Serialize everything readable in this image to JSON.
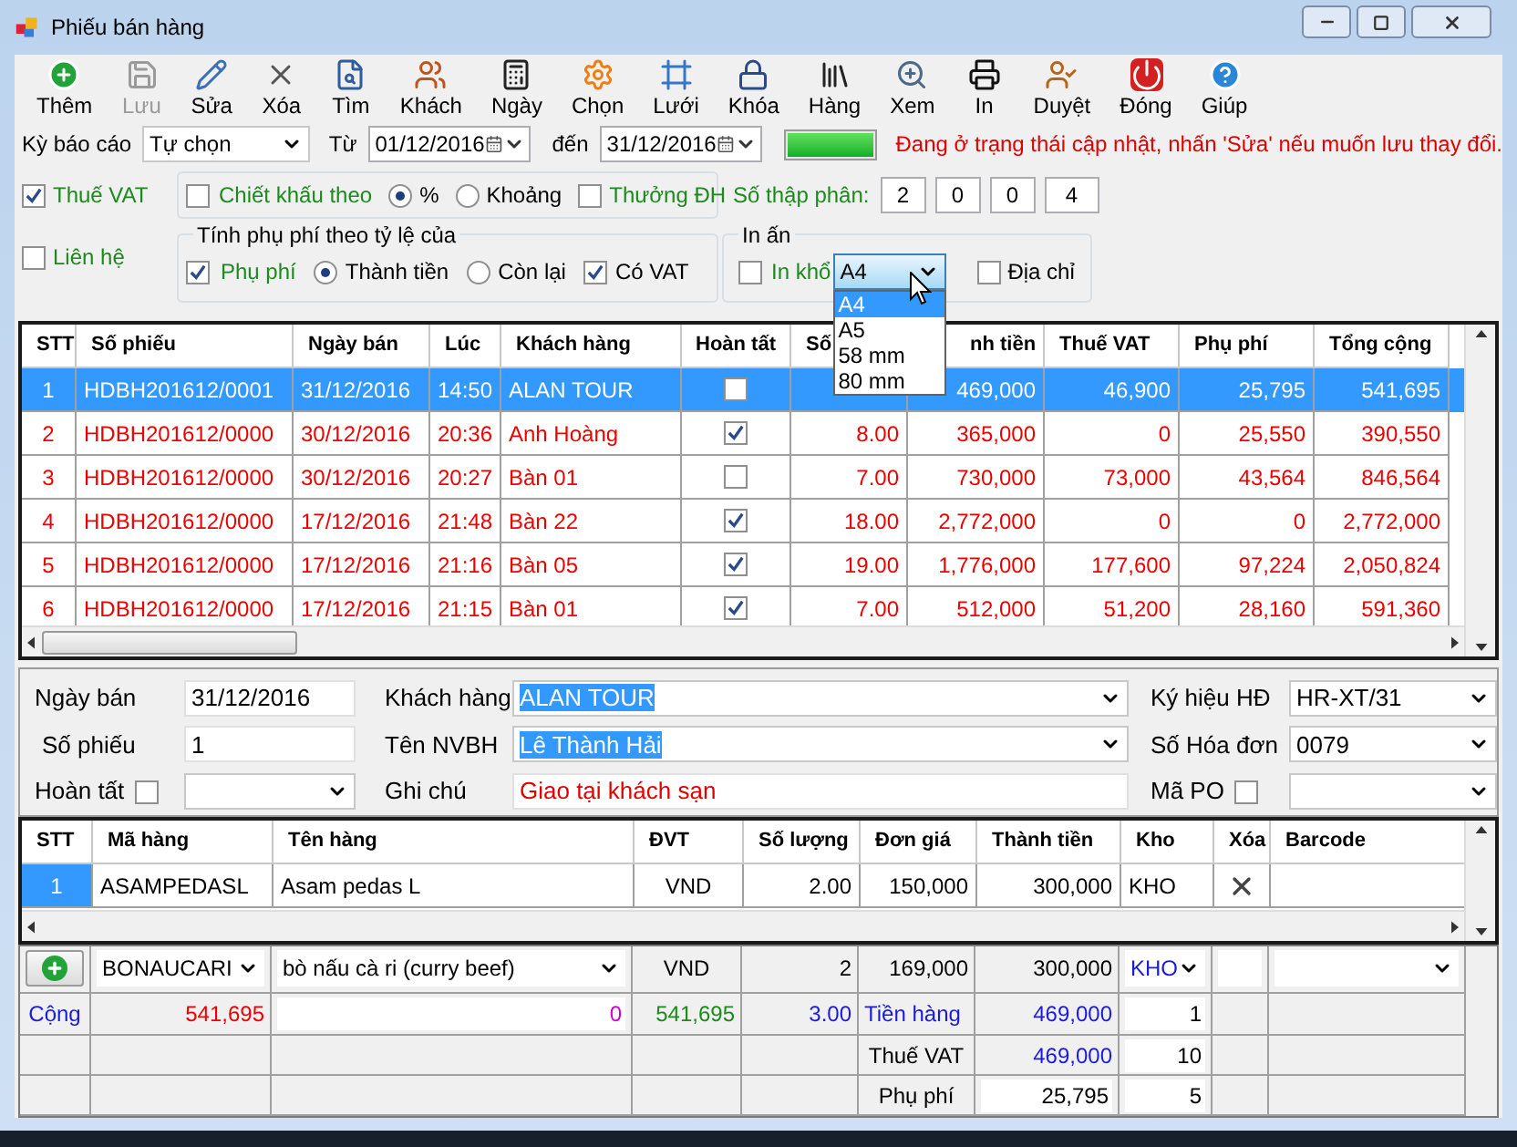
{
  "window": {
    "title": "Phiếu bán hàng"
  },
  "toolbar": [
    {
      "label": "Thêm",
      "disabled": false
    },
    {
      "label": "Lưu",
      "disabled": true
    },
    {
      "label": "Sửa",
      "disabled": false
    },
    {
      "label": "Xóa",
      "disabled": false
    },
    {
      "label": "Tìm",
      "disabled": false
    },
    {
      "label": "Khách",
      "disabled": false
    },
    {
      "label": "Ngày",
      "disabled": false
    },
    {
      "label": "Chọn",
      "disabled": false
    },
    {
      "label": "Lưới",
      "disabled": false
    },
    {
      "label": "Khóa",
      "disabled": false
    },
    {
      "label": "Hàng",
      "disabled": false
    },
    {
      "label": "Xem",
      "disabled": false
    },
    {
      "label": "In",
      "disabled": false
    },
    {
      "label": "Duyệt",
      "disabled": false
    },
    {
      "label": "Đóng",
      "disabled": false
    },
    {
      "label": "Giúp",
      "disabled": false
    }
  ],
  "filters": {
    "period_label": "Kỳ báo cáo",
    "period_value": "Tự chọn",
    "from_label": "Từ",
    "from_value": "01/12/2016",
    "to_label": "đến",
    "to_value": "31/12/2016",
    "progress": {
      "level": 1
    },
    "message": "Đang ở trạng thái cập nhật, nhấn 'Sửa' nếu muốn lưu thay đổi."
  },
  "options": {
    "vat": {
      "label": "Thuế VAT",
      "checked": true
    },
    "discount": {
      "label": "Chiết khấu theo",
      "checked": false
    },
    "discount_modes": [
      {
        "label": "%",
        "selected": true
      },
      {
        "label": "Khoảng",
        "selected": false
      }
    ],
    "bonus": {
      "label": "Thưởng ĐH",
      "checked": false
    },
    "decimals": {
      "label": "Số thập phân:",
      "values": [
        "2",
        "0",
        "0",
        "4"
      ]
    },
    "contact": {
      "label": "Liên hệ",
      "checked": false
    },
    "surcharge_group": {
      "title": "Tính phụ phí theo tỷ lệ của",
      "surcharge": {
        "label": "Phụ phí",
        "checked": true
      },
      "bases": [
        {
          "label": "Thành tiền",
          "selected": true
        },
        {
          "label": "Còn lại",
          "selected": false
        }
      ],
      "with_vat": {
        "label": "Có VAT",
        "checked": true
      }
    },
    "print_group": {
      "title": "In ấn",
      "paper": {
        "label": "In khổ",
        "checked": false
      },
      "paper_size": {
        "value": "A4",
        "expanded": true,
        "options": [
          {
            "label": "A4",
            "selected": true
          },
          {
            "label": "A5",
            "selected": false
          },
          {
            "label": "58 mm",
            "selected": false
          },
          {
            "label": "80 mm",
            "selected": false
          }
        ]
      },
      "address": {
        "label": "Địa chỉ",
        "checked": false
      }
    }
  },
  "invoices": {
    "columns": [
      "STT",
      "Số phiếu",
      "Ngày bán",
      "Lúc",
      "Khách hàng",
      "Hoàn tất",
      "Số",
      "nh tiền",
      "Thuế VAT",
      "Phụ phí",
      "Tổng cộng"
    ],
    "rows": [
      {
        "stt": "1",
        "number": "HDBH201612/0001",
        "date": "31/12/2016",
        "time": "14:50",
        "customer": "ALAN TOUR",
        "completed": false,
        "amount": "469,000",
        "vat": "46,900",
        "surcharge": "25,795",
        "total": "541,695",
        "selected": true
      },
      {
        "stt": "2",
        "number": "HDBH201612/0000",
        "date": "30/12/2016",
        "time": "20:36",
        "customer": "Anh Hoàng",
        "completed": true,
        "quantity": "8.00",
        "amount": "365,000",
        "vat": "0",
        "surcharge": "25,550",
        "total": "390,550",
        "selected": false
      },
      {
        "stt": "3",
        "number": "HDBH201612/0000",
        "date": "30/12/2016",
        "time": "20:27",
        "customer": "Bàn 01",
        "completed": false,
        "quantity": "7.00",
        "amount": "730,000",
        "vat": "73,000",
        "surcharge": "43,564",
        "total": "846,564",
        "selected": false
      },
      {
        "stt": "4",
        "number": "HDBH201612/0000",
        "date": "17/12/2016",
        "time": "21:48",
        "customer": "Bàn 22",
        "completed": true,
        "quantity": "18.00",
        "amount": "2,772,000",
        "vat": "0",
        "surcharge": "0",
        "total": "2,772,000",
        "selected": false
      },
      {
        "stt": "5",
        "number": "HDBH201612/0000",
        "date": "17/12/2016",
        "time": "21:16",
        "customer": "Bàn 05",
        "completed": true,
        "quantity": "19.00",
        "amount": "1,776,000",
        "vat": "177,600",
        "surcharge": "97,224",
        "total": "2,050,824",
        "selected": false
      },
      {
        "stt": "6",
        "number": "HDBH201612/0000",
        "date": "17/12/2016",
        "time": "21:15",
        "customer": "Bàn 01",
        "completed": true,
        "quantity": "7.00",
        "amount": "512,000",
        "vat": "51,200",
        "surcharge": "28,160",
        "total": "591,360",
        "selected": false
      }
    ]
  },
  "invoice": {
    "date": {
      "label": "Ngày bán",
      "value": "31/12/2016"
    },
    "number": {
      "label": "Số phiếu",
      "value": "1"
    },
    "completed": {
      "label": "Hoàn tất",
      "checked": false
    },
    "customer": {
      "label": "Khách hàng",
      "value": "ALAN TOUR",
      "highlighted": true
    },
    "staff": {
      "label": "Tên NVBH",
      "value": "Lê Thành Hải",
      "highlighted": true
    },
    "note": {
      "label": "Ghi chú",
      "value": "Giao tại khách sạn"
    },
    "symbol": {
      "label": "Ký hiệu HĐ",
      "value": "HR-XT/31"
    },
    "invoice_no": {
      "label": "Số Hóa đơn",
      "value": "0079"
    },
    "po": {
      "label": "Mã PO",
      "checked": false
    }
  },
  "items": {
    "columns": [
      "STT",
      "Mã hàng",
      "Tên hàng",
      "ĐVT",
      "Số lượng",
      "Đơn giá",
      "Thành tiền",
      "Kho",
      "Xóa",
      "Barcode"
    ],
    "rows": [
      {
        "selected": true,
        "cells": [
          "1",
          "ASAMPEDASL",
          "Asam pedas L",
          "VND",
          "2.00",
          "150,000",
          "300,000",
          "KHO"
        ]
      }
    ]
  },
  "entry": {
    "code": "BONAUCARI",
    "name": "bò nấu cà ri (curry beef)",
    "unit": "VND",
    "quantity": "2",
    "price": "169,000",
    "amount": "300,000",
    "store": "KHO"
  },
  "totals": {
    "label": "Cộng",
    "total": "541,695",
    "discount": "0",
    "paid": "541,695",
    "quantity": "3.00",
    "rows": [
      {
        "label": "Tiền hàng",
        "value": "469,000",
        "rate": "1"
      },
      {
        "label": "Thuế VAT",
        "value": "469,000",
        "rate": "10"
      },
      {
        "label": "Phụ phí",
        "value": "25,795",
        "rate": "5"
      }
    ]
  }
}
